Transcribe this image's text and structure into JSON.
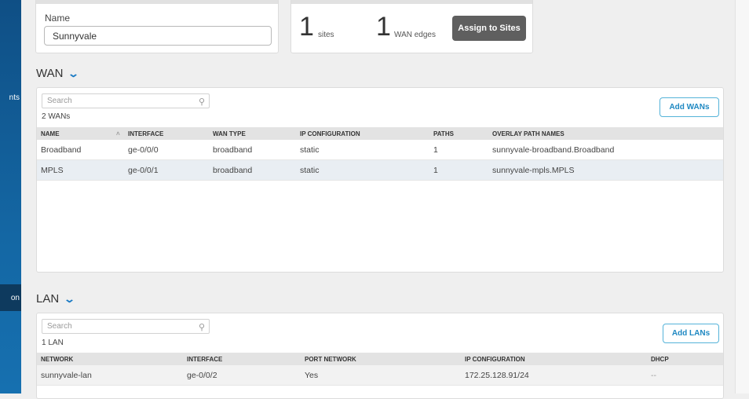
{
  "sidebar": {
    "items": [
      {
        "label": "nts"
      },
      {
        "label": "on",
        "selected": true
      }
    ]
  },
  "name_card": {
    "label": "Name",
    "value": "Sunnyvale"
  },
  "stats_card": {
    "sites_count": "1",
    "sites_label": "sites",
    "edges_count": "1",
    "edges_label": "WAN edges",
    "assign_button": "Assign to Sites"
  },
  "wan": {
    "title": "WAN",
    "search_placeholder": "Search",
    "count": "2 WANs",
    "add_button": "Add WANs",
    "columns": [
      "NAME",
      "INTERFACE",
      "WAN TYPE",
      "IP CONFIGURATION",
      "PATHS",
      "OVERLAY PATH NAMES"
    ],
    "rows": [
      [
        "Broadband",
        "ge-0/0/0",
        "broadband",
        "static",
        "1",
        "sunnyvale-broadband.Broadband"
      ],
      [
        "MPLS",
        "ge-0/0/1",
        "broadband",
        "static",
        "1",
        "sunnyvale-mpls.MPLS"
      ]
    ]
  },
  "lan": {
    "title": "LAN",
    "search_placeholder": "Search",
    "count": "1 LAN",
    "add_button": "Add LANs",
    "columns": [
      "NETWORK",
      "INTERFACE",
      "PORT NETWORK",
      "IP CONFIGURATION",
      "DHCP"
    ],
    "rows": [
      [
        "sunnyvale-lan",
        "ge-0/0/2",
        "Yes",
        "172.25.128.91/24",
        "--"
      ]
    ]
  }
}
